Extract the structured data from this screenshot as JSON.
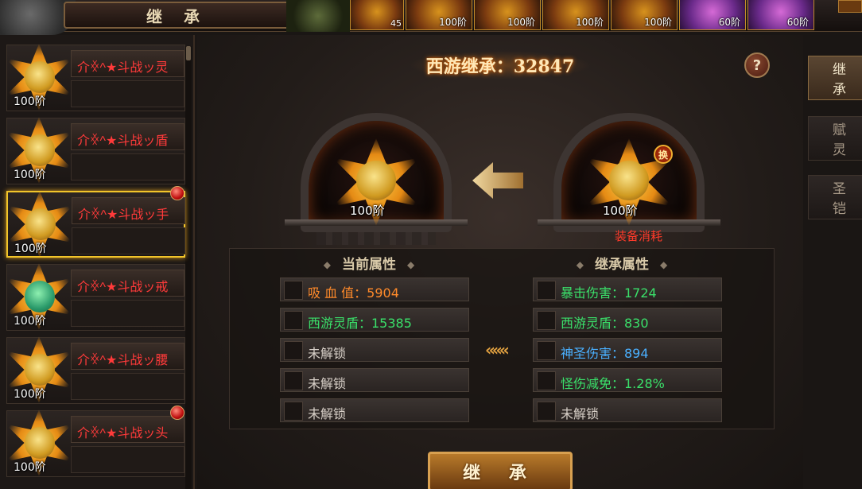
{
  "window": {
    "title": "继 承"
  },
  "top_slots": [
    {
      "level": "",
      "qty": "45",
      "purple": false
    },
    {
      "level": "100阶",
      "qty": "",
      "purple": false
    },
    {
      "level": "100阶",
      "qty": "",
      "purple": false
    },
    {
      "level": "100阶",
      "qty": "",
      "purple": false
    },
    {
      "level": "100阶",
      "qty": "",
      "purple": false
    },
    {
      "level": "60阶",
      "qty": "",
      "purple": true
    },
    {
      "level": "60阶",
      "qty": "",
      "purple": true
    }
  ],
  "equipment_list": [
    {
      "name": "介ꏍ^★斗战ッ灵",
      "level": "100阶",
      "selected": false,
      "core": "gold",
      "dot": false
    },
    {
      "name": "介ꏍ^★斗战ッ盾",
      "level": "100阶",
      "selected": false,
      "core": "gold",
      "dot": false
    },
    {
      "name": "介ꏍ^★斗战ッ手",
      "level": "100阶",
      "selected": true,
      "core": "gold",
      "dot": true
    },
    {
      "name": "介ꏍ^★斗战ッ戒",
      "level": "100阶",
      "selected": false,
      "core": "green",
      "dot": false
    },
    {
      "name": "介ꏍ^★斗战ッ腰",
      "level": "100阶",
      "selected": false,
      "core": "gold",
      "dot": false
    },
    {
      "name": "介ꏍ^★斗战ッ头",
      "level": "100阶",
      "selected": false,
      "core": "gold",
      "dot": true
    }
  ],
  "header": {
    "label": "西游继承",
    "value": "32847",
    "display": "西游继承：32847"
  },
  "help": {
    "label": "?"
  },
  "target_slot": {
    "level": "100阶"
  },
  "source_slot": {
    "level": "100阶",
    "swap_label": "换",
    "caption": "装备消耗"
  },
  "current_attrs": {
    "title": "当前属性",
    "rows": [
      {
        "text": "吸 血 值：5904",
        "color": "orange"
      },
      {
        "text": "西游灵盾：15385",
        "color": "green"
      },
      {
        "text": "未解锁",
        "color": "grey"
      },
      {
        "text": "未解锁",
        "color": "grey"
      },
      {
        "text": "未解锁",
        "color": "grey"
      }
    ]
  },
  "inherit_attrs": {
    "title": "继承属性",
    "rows": [
      {
        "text": "暴击伤害：1724",
        "color": "green"
      },
      {
        "text": "西游灵盾：830",
        "color": "green"
      },
      {
        "text": "神圣伤害：894",
        "color": "blue"
      },
      {
        "text": "怪伤减免：1.28%",
        "color": "green"
      },
      {
        "text": "未解锁",
        "color": "grey"
      }
    ]
  },
  "transfer_arrow": "«««",
  "inherit_button": {
    "label": "继 承"
  },
  "side_tabs": [
    {
      "label": "继 承",
      "active": true
    },
    {
      "label": "赋 灵",
      "active": false
    },
    {
      "label": "圣 铠",
      "active": false
    }
  ],
  "colors": {
    "accent": "#f2c52a",
    "name_red": "#ff3a3a",
    "attr_orange": "#ff8a2a",
    "attr_green": "#3ae06a",
    "attr_blue": "#4ab0ff"
  }
}
